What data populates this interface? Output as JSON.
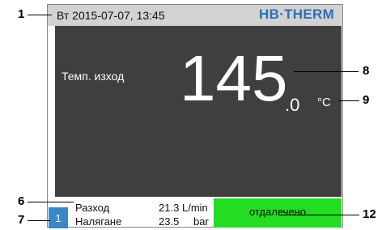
{
  "header": {
    "date_time": "Вт  2015-07-07, 13:45",
    "brand": "HB·THERM"
  },
  "main": {
    "parameter_label": "Темп. изход",
    "value_integer": "145",
    "value_decimal": ".0",
    "unit": "°C"
  },
  "status": {
    "unit_number": "1",
    "rows": [
      {
        "label": "Разход",
        "value": "21.3",
        "unit": "L/min"
      },
      {
        "label": "Налягане",
        "value": "23.5",
        "unit": "bar"
      }
    ],
    "mode": "отдалечено",
    "mode_color": "#22dd22"
  },
  "callouts": [
    "1",
    "6",
    "7",
    "8",
    "9",
    "12"
  ],
  "colors": {
    "header_bg": "#d2d2d2",
    "main_bg": "#3f3f3f",
    "brand": "#2d6fb3",
    "badge": "#3b87c6"
  }
}
